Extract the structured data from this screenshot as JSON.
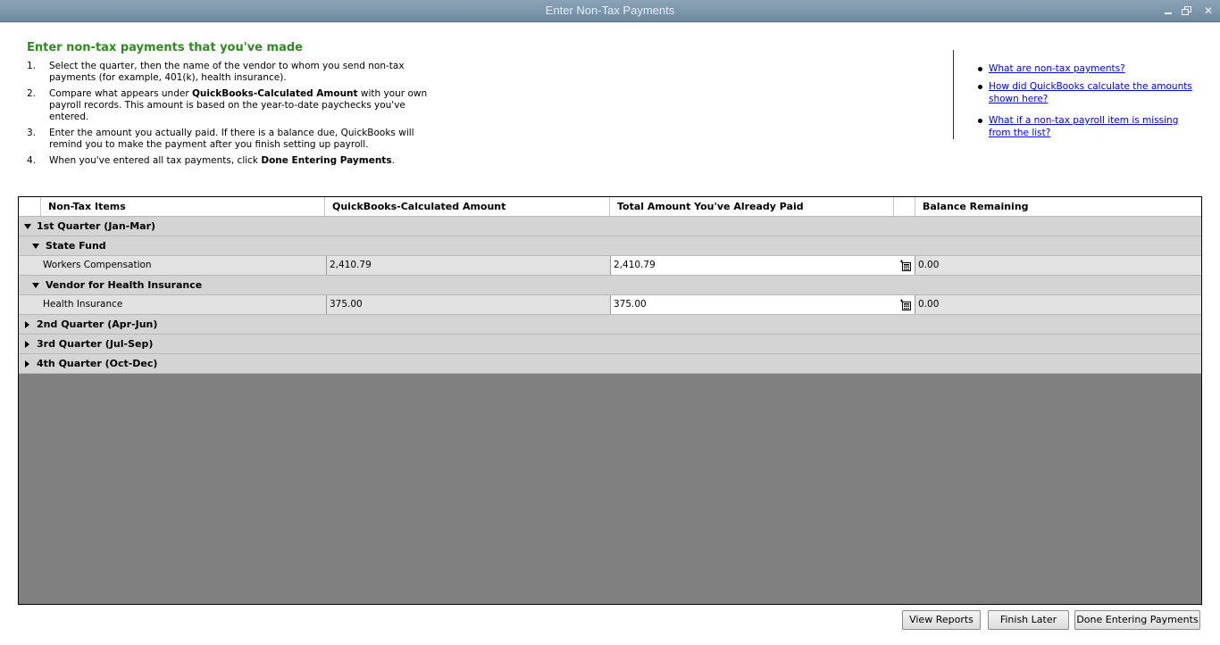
{
  "window": {
    "title": "Enter Non-Tax Payments"
  },
  "instructions": {
    "heading": "Enter non-tax payments that you've made",
    "steps": [
      {
        "num": "1.",
        "parts": [
          "Select the quarter, then the name of the vendor to whom you send non-tax payments (for example, 401(k), health insurance)."
        ]
      },
      {
        "num": "2.",
        "pre": "Compare what appears under ",
        "bold": "QuickBooks-Calculated Amount",
        "post": " with your own payroll records. This amount is based on the year-to-date paychecks you've entered."
      },
      {
        "num": "3.",
        "text": "Enter the amount you actually paid. If there is a balance due, QuickBooks will remind you to make the payment after you finish setting up payroll."
      },
      {
        "num": "4.",
        "pre": "When you've entered all tax payments, click ",
        "bold": "Done Entering Payments",
        "post": "."
      }
    ]
  },
  "help_links": [
    "What are non-tax payments?",
    "How did QuickBooks calculate the amounts shown here?",
    "What if a non-tax payroll item is missing from the list?"
  ],
  "grid": {
    "columns": [
      "Non-Tax Items",
      "QuickBooks-Calculated Amount",
      "Total Amount You've Already Paid",
      "Balance Remaining"
    ],
    "quarters": [
      {
        "label": "1st Quarter (Jan-Mar)",
        "expanded": true,
        "vendors": [
          {
            "label": "State Fund",
            "items": [
              {
                "name": "Workers Compensation",
                "calculated": "2,410.79",
                "paid": "2,410.79",
                "balance": "0.00"
              }
            ]
          },
          {
            "label": "Vendor for Health Insurance",
            "items": [
              {
                "name": "Health Insurance",
                "calculated": "375.00",
                "paid": "375.00",
                "balance": "0.00"
              }
            ]
          }
        ]
      },
      {
        "label": "2nd Quarter (Apr-Jun)",
        "expanded": false
      },
      {
        "label": "3rd Quarter (Jul-Sep)",
        "expanded": false
      },
      {
        "label": "4th Quarter (Oct-Dec)",
        "expanded": false
      }
    ]
  },
  "buttons": {
    "view_reports": "View Reports",
    "finish_later": "Finish Later",
    "done": "Done Entering Payments"
  },
  "colors": {
    "heading": "#2e8b1e",
    "link": "#0000ee",
    "titlebar": "#7d97ab"
  }
}
